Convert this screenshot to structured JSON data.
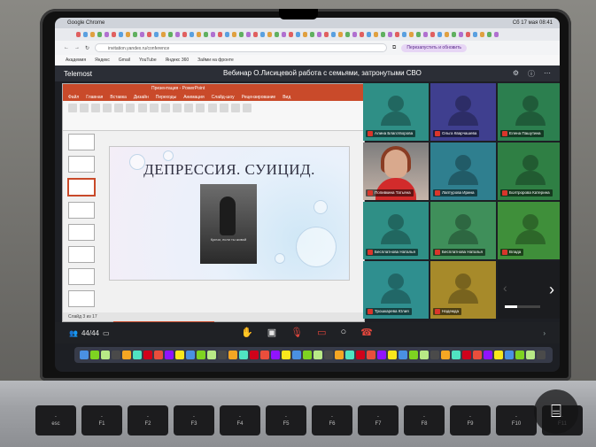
{
  "browser": {
    "menubar_left": "Google Chrome",
    "menubar_right": "Сб 17 мая 08:41",
    "url": "invitation.yandex.ru/conference",
    "pill": "Перезапустить и обновить",
    "bookmarks": [
      "Академия",
      "Яндекс",
      "Gmail",
      "YouTube",
      "Яндекс 360",
      "Займи на фронте"
    ]
  },
  "meeting": {
    "app_name": "Telemost",
    "title": "Вебинар О.Лисицевой работа с семьями, затронутыми СВО",
    "participant_count": "44/44"
  },
  "powerpoint": {
    "window_title": "Презентация - PowerPoint",
    "tabs": [
      "Файл",
      "Главная",
      "Вставка",
      "Дизайн",
      "Переходы",
      "Анимация",
      "Слайд-шоу",
      "Рецензирование",
      "Вид"
    ],
    "slide_title": "ДЕПРЕССИЯ. СУИЦИД.",
    "slide_caption": "Кричи, если ты живой",
    "status_text": "Слайд 3 из 17",
    "notification": "Демонстрация экрана"
  },
  "participants": [
    {
      "name": "Алина Благотворова",
      "bg": "#2f8f86",
      "type": "avatar"
    },
    {
      "name": "Ольга Кварчашева",
      "bg": "#3f3f8f",
      "type": "avatar"
    },
    {
      "name": "Елена Пашутина",
      "bg": "#2c7f4f",
      "type": "avatar"
    },
    {
      "name": "Попивкина Татьяна",
      "bg": "#9a9a9a",
      "type": "video"
    },
    {
      "name": "Лаптурова Ирина",
      "bg": "#2f7f8f",
      "type": "avatar"
    },
    {
      "name": "Болтророва Катерина",
      "bg": "#2f7f44",
      "type": "avatar"
    },
    {
      "name": "Бесплатнова Наталья",
      "bg": "#2f8f86",
      "type": "avatar"
    },
    {
      "name": "Бесплатнова Наталья",
      "bg": "#3f8f5a",
      "type": "avatar"
    },
    {
      "name": "Влада",
      "bg": "#3f8f3a",
      "type": "avatar"
    },
    {
      "name": "Трошкарева Юлия",
      "bg": "#2f8f8f",
      "type": "avatar"
    },
    {
      "name": "Надежда",
      "bg": "#a78a2a",
      "type": "avatar"
    }
  ],
  "keyboard": [
    "esc",
    "F1",
    "F2",
    "F3",
    "F4",
    "F5",
    "F6",
    "F7",
    "F8",
    "F9",
    "F10",
    "F11",
    "F12"
  ],
  "colors": {
    "ppt_accent": "#c94a2a",
    "end_call": "#e0463c",
    "meeting_bar": "#2b2e36"
  },
  "icons": {
    "scan": "text-recognition-icon",
    "next": "chevron-right-icon"
  }
}
